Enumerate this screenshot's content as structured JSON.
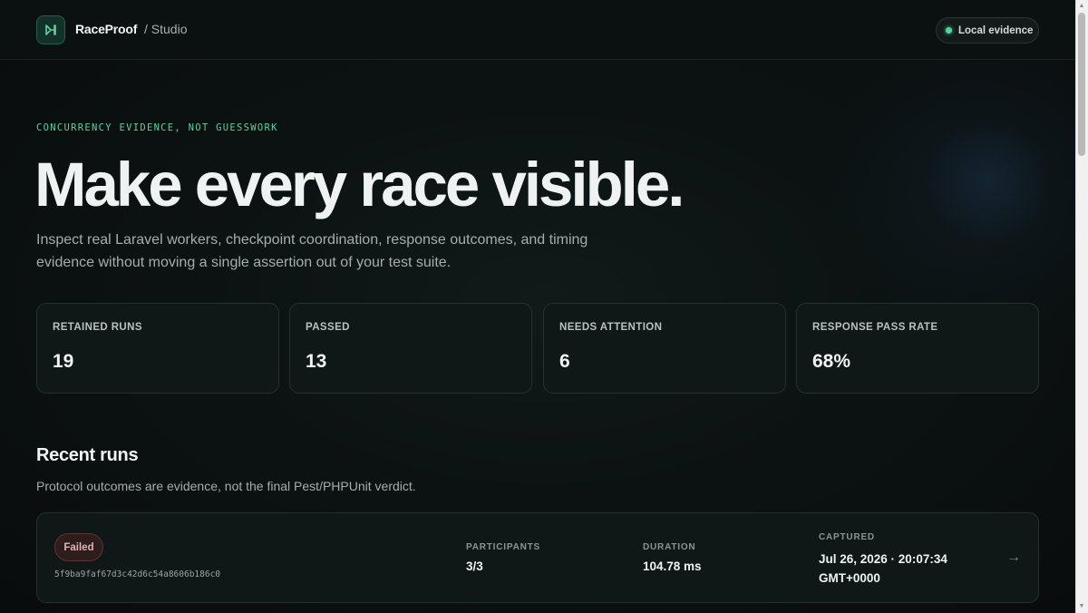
{
  "header": {
    "brand": "RaceProof",
    "breadcrumb": "/ Studio",
    "status_badge": "Local evidence"
  },
  "hero": {
    "eyebrow": "CONCURRENCY EVIDENCE, NOT GUESSWORK",
    "title": "Make every race visible.",
    "subtitle": "Inspect real Laravel workers, checkpoint coordination, response outcomes, and timing evidence without moving a single assertion out of your test suite."
  },
  "stats": [
    {
      "label": "RETAINED RUNS",
      "value": "19"
    },
    {
      "label": "PASSED",
      "value": "13"
    },
    {
      "label": "NEEDS ATTENTION",
      "value": "6"
    },
    {
      "label": "RESPONSE PASS RATE",
      "value": "68%"
    }
  ],
  "recent_runs": {
    "title": "Recent runs",
    "subtitle": "Protocol outcomes are evidence, not the final Pest/PHPUnit verdict.",
    "columns": {
      "participants": "PARTICIPANTS",
      "duration": "DURATION",
      "captured": "CAPTURED"
    },
    "items": [
      {
        "status": "Failed",
        "hash": "5f9ba9faf67d3c42d6c54a8606b186c0",
        "participants": "3/3",
        "duration": "104.78 ms",
        "captured": "Jul 26, 2026 · 20:07:34 GMT+0000",
        "arrow": "→"
      }
    ]
  },
  "colors": {
    "accent": "#5fd0a2",
    "status_dot": "#4fd49a",
    "failed_bg": "#2e1d1d",
    "failed_text": "#e2b2b2"
  },
  "icons": {
    "logo": "raceproof-logo-icon",
    "status": "status-dot-icon",
    "open": "arrow-right-icon"
  }
}
